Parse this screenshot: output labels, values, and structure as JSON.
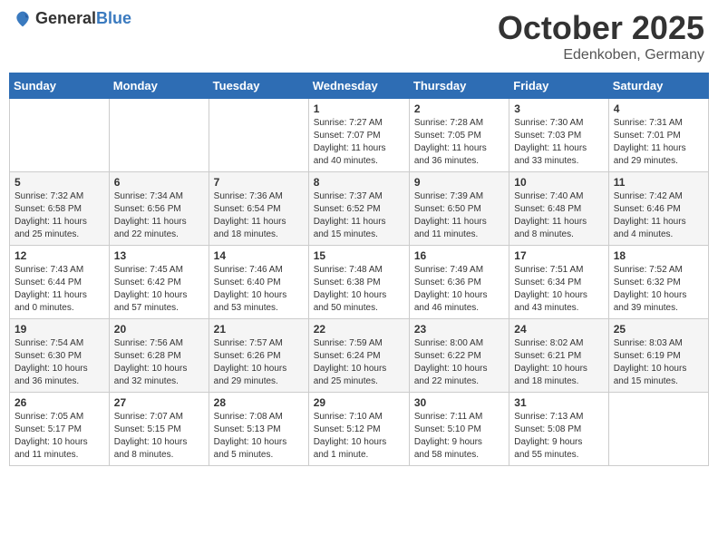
{
  "header": {
    "logo_general": "General",
    "logo_blue": "Blue",
    "month": "October 2025",
    "location": "Edenkoben, Germany"
  },
  "weekdays": [
    "Sunday",
    "Monday",
    "Tuesday",
    "Wednesday",
    "Thursday",
    "Friday",
    "Saturday"
  ],
  "weeks": [
    [
      {
        "day": "",
        "info": ""
      },
      {
        "day": "",
        "info": ""
      },
      {
        "day": "",
        "info": ""
      },
      {
        "day": "1",
        "info": "Sunrise: 7:27 AM\nSunset: 7:07 PM\nDaylight: 11 hours\nand 40 minutes."
      },
      {
        "day": "2",
        "info": "Sunrise: 7:28 AM\nSunset: 7:05 PM\nDaylight: 11 hours\nand 36 minutes."
      },
      {
        "day": "3",
        "info": "Sunrise: 7:30 AM\nSunset: 7:03 PM\nDaylight: 11 hours\nand 33 minutes."
      },
      {
        "day": "4",
        "info": "Sunrise: 7:31 AM\nSunset: 7:01 PM\nDaylight: 11 hours\nand 29 minutes."
      }
    ],
    [
      {
        "day": "5",
        "info": "Sunrise: 7:32 AM\nSunset: 6:58 PM\nDaylight: 11 hours\nand 25 minutes."
      },
      {
        "day": "6",
        "info": "Sunrise: 7:34 AM\nSunset: 6:56 PM\nDaylight: 11 hours\nand 22 minutes."
      },
      {
        "day": "7",
        "info": "Sunrise: 7:36 AM\nSunset: 6:54 PM\nDaylight: 11 hours\nand 18 minutes."
      },
      {
        "day": "8",
        "info": "Sunrise: 7:37 AM\nSunset: 6:52 PM\nDaylight: 11 hours\nand 15 minutes."
      },
      {
        "day": "9",
        "info": "Sunrise: 7:39 AM\nSunset: 6:50 PM\nDaylight: 11 hours\nand 11 minutes."
      },
      {
        "day": "10",
        "info": "Sunrise: 7:40 AM\nSunset: 6:48 PM\nDaylight: 11 hours\nand 8 minutes."
      },
      {
        "day": "11",
        "info": "Sunrise: 7:42 AM\nSunset: 6:46 PM\nDaylight: 11 hours\nand 4 minutes."
      }
    ],
    [
      {
        "day": "12",
        "info": "Sunrise: 7:43 AM\nSunset: 6:44 PM\nDaylight: 11 hours\nand 0 minutes."
      },
      {
        "day": "13",
        "info": "Sunrise: 7:45 AM\nSunset: 6:42 PM\nDaylight: 10 hours\nand 57 minutes."
      },
      {
        "day": "14",
        "info": "Sunrise: 7:46 AM\nSunset: 6:40 PM\nDaylight: 10 hours\nand 53 minutes."
      },
      {
        "day": "15",
        "info": "Sunrise: 7:48 AM\nSunset: 6:38 PM\nDaylight: 10 hours\nand 50 minutes."
      },
      {
        "day": "16",
        "info": "Sunrise: 7:49 AM\nSunset: 6:36 PM\nDaylight: 10 hours\nand 46 minutes."
      },
      {
        "day": "17",
        "info": "Sunrise: 7:51 AM\nSunset: 6:34 PM\nDaylight: 10 hours\nand 43 minutes."
      },
      {
        "day": "18",
        "info": "Sunrise: 7:52 AM\nSunset: 6:32 PM\nDaylight: 10 hours\nand 39 minutes."
      }
    ],
    [
      {
        "day": "19",
        "info": "Sunrise: 7:54 AM\nSunset: 6:30 PM\nDaylight: 10 hours\nand 36 minutes."
      },
      {
        "day": "20",
        "info": "Sunrise: 7:56 AM\nSunset: 6:28 PM\nDaylight: 10 hours\nand 32 minutes."
      },
      {
        "day": "21",
        "info": "Sunrise: 7:57 AM\nSunset: 6:26 PM\nDaylight: 10 hours\nand 29 minutes."
      },
      {
        "day": "22",
        "info": "Sunrise: 7:59 AM\nSunset: 6:24 PM\nDaylight: 10 hours\nand 25 minutes."
      },
      {
        "day": "23",
        "info": "Sunrise: 8:00 AM\nSunset: 6:22 PM\nDaylight: 10 hours\nand 22 minutes."
      },
      {
        "day": "24",
        "info": "Sunrise: 8:02 AM\nSunset: 6:21 PM\nDaylight: 10 hours\nand 18 minutes."
      },
      {
        "day": "25",
        "info": "Sunrise: 8:03 AM\nSunset: 6:19 PM\nDaylight: 10 hours\nand 15 minutes."
      }
    ],
    [
      {
        "day": "26",
        "info": "Sunrise: 7:05 AM\nSunset: 5:17 PM\nDaylight: 10 hours\nand 11 minutes."
      },
      {
        "day": "27",
        "info": "Sunrise: 7:07 AM\nSunset: 5:15 PM\nDaylight: 10 hours\nand 8 minutes."
      },
      {
        "day": "28",
        "info": "Sunrise: 7:08 AM\nSunset: 5:13 PM\nDaylight: 10 hours\nand 5 minutes."
      },
      {
        "day": "29",
        "info": "Sunrise: 7:10 AM\nSunset: 5:12 PM\nDaylight: 10 hours\nand 1 minute."
      },
      {
        "day": "30",
        "info": "Sunrise: 7:11 AM\nSunset: 5:10 PM\nDaylight: 9 hours\nand 58 minutes."
      },
      {
        "day": "31",
        "info": "Sunrise: 7:13 AM\nSunset: 5:08 PM\nDaylight: 9 hours\nand 55 minutes."
      },
      {
        "day": "",
        "info": ""
      }
    ]
  ]
}
